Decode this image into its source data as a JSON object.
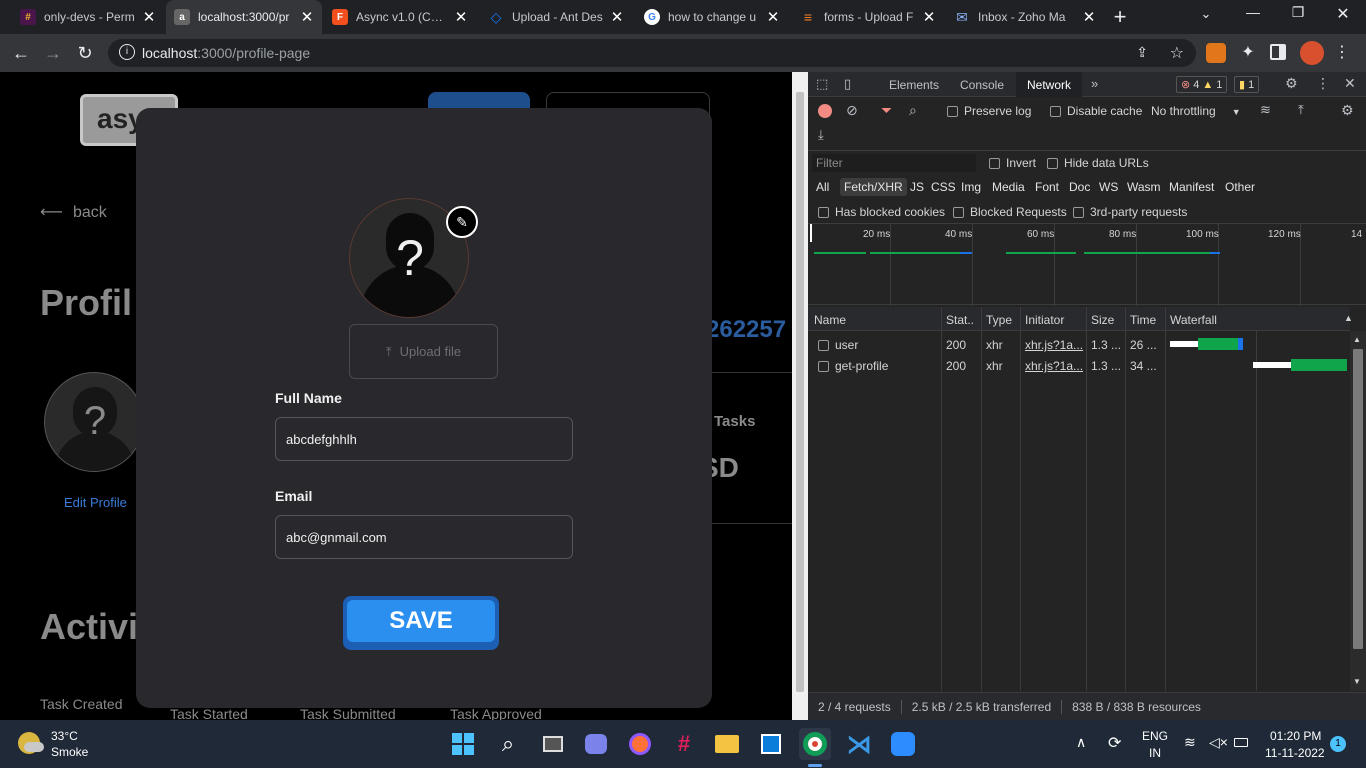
{
  "tabs": [
    {
      "title": "only-devs - Perm",
      "fav_bg": "#4a154b",
      "fav_icon": "#"
    },
    {
      "title": "localhost:3000/pr",
      "fav_bg": "#555",
      "fav_icon": "a"
    },
    {
      "title": "Async v1.0 (Copy",
      "fav_bg": "#f24e1e",
      "fav_icon": "F"
    },
    {
      "title": "Upload - Ant Des",
      "fav_bg": "#1677ff",
      "fav_icon": "◇"
    },
    {
      "title": "how to change u",
      "fav_bg": "#ffffff",
      "fav_icon": "G"
    },
    {
      "title": "forms - Upload F",
      "fav_bg": "#f48024",
      "fav_icon": "≡"
    },
    {
      "title": "Inbox - Zoho Ma",
      "fav_bg": "#2c7be5",
      "fav_icon": "✉"
    }
  ],
  "browser": {
    "url_host": "localhost",
    "url_path": ":3000/profile-page"
  },
  "page": {
    "logo": "asy",
    "back": "back",
    "profile_heading": "Profil",
    "edit_profile": "Edit Profile",
    "number_fragment": "262257",
    "tasks": "Tasks",
    "sd": "SD",
    "activity_heading": "Activit",
    "task_created": "Task Created",
    "task_started": "Task Started",
    "task_submitted": "Task Submitted",
    "task_approved": "Task Approved"
  },
  "modal": {
    "upload_label": "Upload file",
    "full_name_label": "Full Name",
    "full_name_value": "abcdefghhlh",
    "email_label": "Email",
    "email_value": "abc@gnmail.com",
    "save_label": "SAVE"
  },
  "devtools": {
    "tabs": [
      "Elements",
      "Console",
      "Network"
    ],
    "active_tab": "Network",
    "errors": "4",
    "warnings": "1",
    "info": "1",
    "preserve_log": "Preserve log",
    "disable_cache": "Disable cache",
    "throttling": "No throttling",
    "filter_placeholder": "Filter",
    "invert": "Invert",
    "hide_data_urls": "Hide data URLs",
    "filter_types": [
      "All",
      "Fetch/XHR",
      "JS",
      "CSS",
      "Img",
      "Media",
      "Font",
      "Doc",
      "WS",
      "Wasm",
      "Manifest",
      "Other"
    ],
    "active_filter": "Fetch/XHR",
    "has_blocked_cookies": "Has blocked cookies",
    "blocked_requests": "Blocked Requests",
    "third_party": "3rd-party requests",
    "timeline_ticks": [
      "20 ms",
      "40 ms",
      "60 ms",
      "80 ms",
      "100 ms",
      "120 ms",
      "14"
    ],
    "columns": [
      "Name",
      "Stat..",
      "Type",
      "Initiator",
      "Size",
      "Time",
      "Waterfall"
    ],
    "rows": [
      {
        "name": "user",
        "status": "200",
        "type": "xhr",
        "initiator": "xhr.js?1a...",
        "size": "1.3 ...",
        "time": "26 ..."
      },
      {
        "name": "get-profile",
        "status": "200",
        "type": "xhr",
        "initiator": "xhr.js?1a...",
        "size": "1.3 ...",
        "time": "34 ..."
      }
    ],
    "status_requests": "2 / 4 requests",
    "status_transferred": "2.5 kB / 2.5 kB transferred",
    "status_resources": "838 B / 838 B resources"
  },
  "taskbar": {
    "temp": "33°C",
    "weather": "Smoke",
    "lang": "ENG",
    "region": "IN",
    "time": "01:20 PM",
    "date": "11-11-2022",
    "notifications": "1"
  },
  "colors": {
    "accent_blue": "#1e88e5",
    "save_button": "#2b8ff0",
    "link_blue": "#3b7dd8",
    "waterfall_green": "#10a54a"
  }
}
